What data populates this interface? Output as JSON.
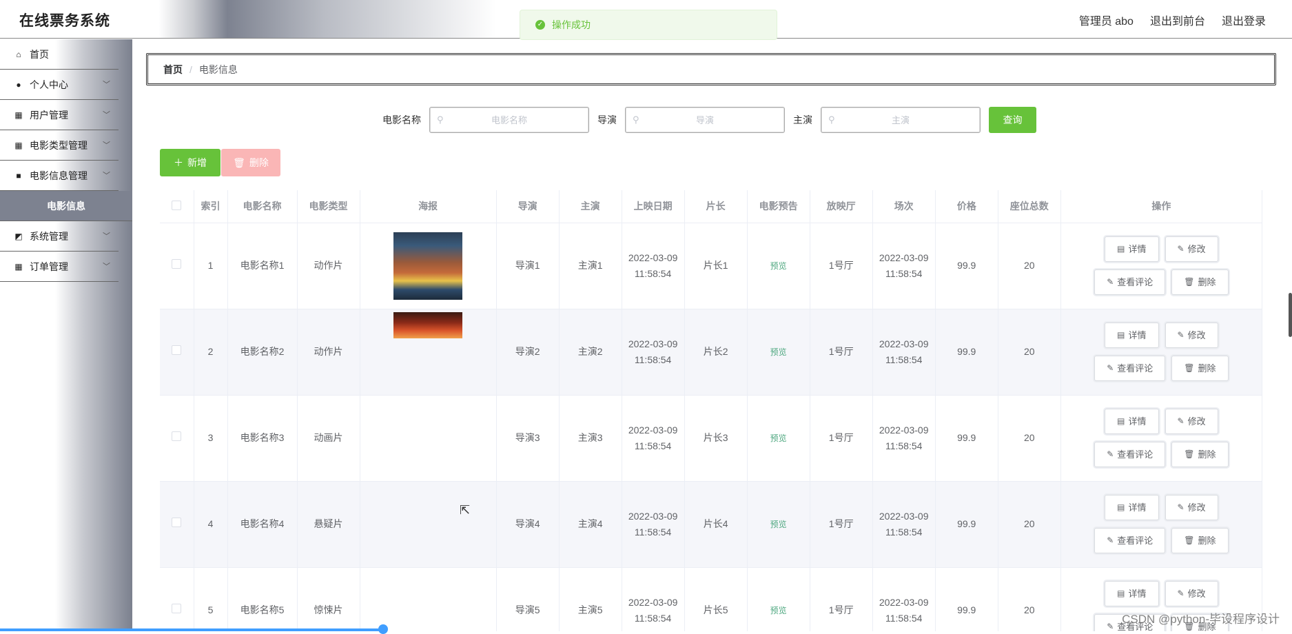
{
  "app": {
    "title": "在线票务系统"
  },
  "header": {
    "user": "管理员 abo",
    "front": "退出到前台",
    "logout": "退出登录"
  },
  "toast": {
    "message": "操作成功"
  },
  "sidebar": {
    "items": [
      {
        "label": "首页",
        "icon": "home-icon"
      },
      {
        "label": "个人中心",
        "icon": "user-icon"
      },
      {
        "label": "用户管理",
        "icon": "grid-icon"
      },
      {
        "label": "电影类型管理",
        "icon": "grid-icon"
      },
      {
        "label": "电影信息管理",
        "icon": "briefcase-icon"
      },
      {
        "label": "系统管理",
        "icon": "chart-icon"
      },
      {
        "label": "订单管理",
        "icon": "grid-icon"
      }
    ],
    "active_sub": "电影信息"
  },
  "breadcrumb": {
    "home": "首页",
    "sep": "/",
    "current": "电影信息"
  },
  "search": {
    "fields": [
      {
        "label": "电影名称",
        "placeholder": "电影名称"
      },
      {
        "label": "导演",
        "placeholder": "导演"
      },
      {
        "label": "主演",
        "placeholder": "主演"
      }
    ],
    "button": "查询"
  },
  "toolbar": {
    "add": "新增",
    "delete": "删除"
  },
  "table": {
    "headers": [
      "索引",
      "电影名称",
      "电影类型",
      "海报",
      "导演",
      "主演",
      "上映日期",
      "片长",
      "电影预告",
      "放映厅",
      "场次",
      "价格",
      "座位总数",
      "操作"
    ],
    "rows": [
      {
        "index": "1",
        "name": "电影名称1",
        "type": "动作片",
        "director": "导演1",
        "actor": "主演1",
        "date": "2022-03-09 11:58:54",
        "length": "片长1",
        "trailer": "预览",
        "hall": "1号厅",
        "session": "2022-03-09 11:58:54",
        "price": "99.9",
        "seats": "20"
      },
      {
        "index": "2",
        "name": "电影名称2",
        "type": "动作片",
        "director": "导演2",
        "actor": "主演2",
        "date": "2022-03-09 11:58:54",
        "length": "片长2",
        "trailer": "预览",
        "hall": "1号厅",
        "session": "2022-03-09 11:58:54",
        "price": "99.9",
        "seats": "20"
      },
      {
        "index": "3",
        "name": "电影名称3",
        "type": "动画片",
        "director": "导演3",
        "actor": "主演3",
        "date": "2022-03-09 11:58:54",
        "length": "片长3",
        "trailer": "预览",
        "hall": "1号厅",
        "session": "2022-03-09 11:58:54",
        "price": "99.9",
        "seats": "20"
      },
      {
        "index": "4",
        "name": "电影名称4",
        "type": "悬疑片",
        "director": "导演4",
        "actor": "主演4",
        "date": "2022-03-09 11:58:54",
        "length": "片长4",
        "trailer": "预览",
        "hall": "1号厅",
        "session": "2022-03-09 11:58:54",
        "price": "99.9",
        "seats": "20"
      },
      {
        "index": "5",
        "name": "电影名称5",
        "type": "惊悚片",
        "director": "导演5",
        "actor": "主演5",
        "date": "2022-03-09 11:58:54",
        "length": "片长5",
        "trailer": "预览",
        "hall": "1号厅",
        "session": "2022-03-09 11:58:54",
        "price": "99.9",
        "seats": "20"
      }
    ],
    "actions": {
      "detail": "详情",
      "edit": "修改",
      "comments": "查看评论",
      "delete": "删除"
    }
  },
  "watermark": "CSDN @python-毕设程序设计",
  "colors": {
    "primary_green": "#67c23a",
    "danger_light": "#fab6b6",
    "progress_blue": "#409eff"
  }
}
